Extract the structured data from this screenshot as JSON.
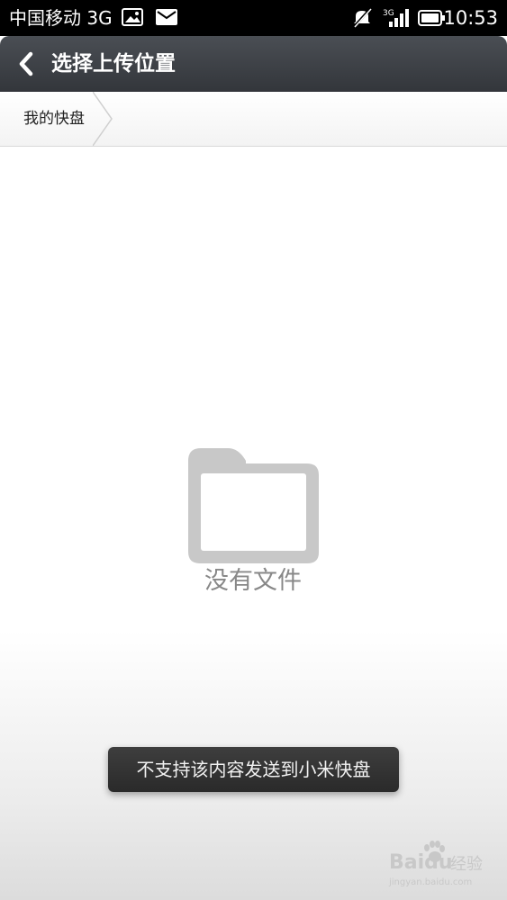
{
  "status_bar": {
    "carrier": "中国移动 3G",
    "time": "10:53",
    "icons": [
      "image-notification-icon",
      "mail-icon",
      "mute-icon",
      "signal-3g-icon",
      "battery-icon"
    ]
  },
  "title_bar": {
    "title": "选择上传位置",
    "back_icon": "chevron-left-icon"
  },
  "breadcrumb": {
    "items": [
      {
        "label": "我的快盘"
      }
    ]
  },
  "empty_state": {
    "icon": "folder-icon",
    "text": "没有文件"
  },
  "toast": {
    "message": "不支持该内容发送到小米快盘"
  },
  "watermark": {
    "brand": "Baidu",
    "cn": "经验",
    "url": "jingyan.baidu.com"
  },
  "colors": {
    "title_bar": "#3a3d42",
    "status_bar": "#000000",
    "toast": "#333333",
    "empty_text": "#888888",
    "folder": "#c8c8c8"
  }
}
